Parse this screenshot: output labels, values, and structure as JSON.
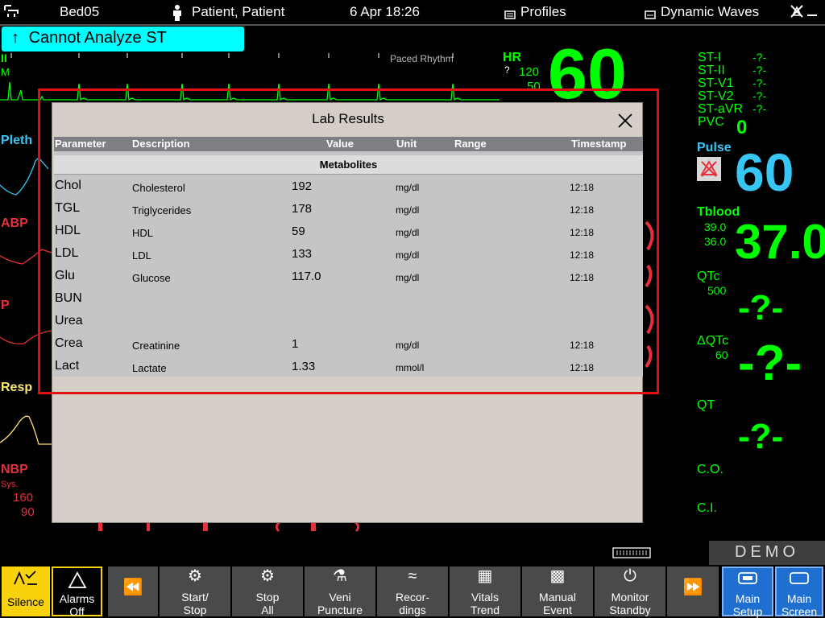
{
  "topbar": {
    "bed": "Bed05",
    "patient": "Patient, Patient",
    "datetime": "6 Apr 18:26",
    "profiles": "Profiles",
    "waves": "Dynamic Waves"
  },
  "st_banner": "Cannot Analyze ST",
  "waves": {
    "ecg_lead": "II",
    "ecg_mode": "M",
    "paced": "Paced Rhythm",
    "pleth": "Pleth",
    "abp": "ABP",
    "p": "P",
    "resp": "Resp",
    "nbp": "NBP",
    "nbp_sys": "Sys.",
    "nbp_hi": "160",
    "nbp_lo": "90"
  },
  "hr": {
    "label": "HR",
    "hi": "120",
    "lo": "50",
    "value": "60",
    "flag": "?"
  },
  "st": [
    {
      "label": "ST-I",
      "value": "-?-"
    },
    {
      "label": "ST-II",
      "value": "-?-"
    },
    {
      "label": "ST-V1",
      "value": "-?-"
    },
    {
      "label": "ST-V2",
      "value": "-?-"
    },
    {
      "label": "ST-aVR",
      "value": "-?-"
    }
  ],
  "pvc": {
    "label": "PVC",
    "value": "0"
  },
  "pulse": {
    "label": "Pulse",
    "value": "60"
  },
  "tblood": {
    "label": "Tblood",
    "hi": "39.0",
    "lo": "36.0",
    "value": "37.0"
  },
  "qtc": {
    "label": "QTc",
    "limit": "500",
    "value": "-?-"
  },
  "dqtc": {
    "label": "ΔQTc",
    "limit": "60",
    "value": "-?-"
  },
  "qt": {
    "label": "QT",
    "value": "-?-"
  },
  "co": {
    "label": "C.O."
  },
  "ci": {
    "label": "C.I."
  },
  "dialog": {
    "title": "Lab  Results",
    "columns": [
      "Parameter",
      "Description",
      "Value",
      "Unit",
      "Range",
      "Timestamp"
    ],
    "section": "Metabolites",
    "rows": [
      {
        "param": "Chol",
        "desc": "Cholesterol",
        "value": "192",
        "unit": "mg/dl",
        "ts": "12:18"
      },
      {
        "param": "TGL",
        "desc": "Triglycerides",
        "value": "178",
        "unit": "mg/dl",
        "ts": "12:18"
      },
      {
        "param": "HDL",
        "desc": "HDL",
        "value": "59",
        "unit": "mg/dl",
        "ts": "12:18"
      },
      {
        "param": "LDL",
        "desc": "LDL",
        "value": "133",
        "unit": "mg/dl",
        "ts": "12:18"
      },
      {
        "param": "Glu",
        "desc": "Glucose",
        "value": "117.0",
        "unit": "mg/dl",
        "ts": "12:18"
      },
      {
        "param": "BUN",
        "desc": "",
        "value": "",
        "unit": "",
        "ts": ""
      },
      {
        "param": "Urea",
        "desc": "",
        "value": "",
        "unit": "",
        "ts": ""
      },
      {
        "param": "Crea",
        "desc": "Creatinine",
        "value": "1",
        "unit": "mg/dl",
        "ts": "12:18"
      },
      {
        "param": "Lact",
        "desc": "Lactate",
        "value": "1.33",
        "unit": "mmol/l",
        "ts": "12:18"
      }
    ]
  },
  "demo": "DEMO",
  "bottom": {
    "silence": "Silence",
    "alarms_off": [
      "Alarms",
      "Off"
    ],
    "start_stop": [
      "Start/",
      "Stop"
    ],
    "stop_all": [
      "Stop",
      "All"
    ],
    "veni": [
      "Veni",
      "Puncture"
    ],
    "recordings": [
      "Recor-",
      "dings"
    ],
    "vitals": [
      "Vitals",
      "Trend"
    ],
    "manual": [
      "Manual",
      "Event"
    ],
    "standby": [
      "Monitor",
      "Standby"
    ],
    "main_setup": [
      "Main",
      "Setup"
    ],
    "main_screen": [
      "Main",
      "Screen"
    ]
  },
  "colors": {
    "ecg": "#00ff00",
    "pleth": "#38c6f4",
    "abp": "#e8303a",
    "resp": "#ffe870",
    "alarm_yellow": "#f8d20c",
    "highlight_frame": "#e01010"
  }
}
